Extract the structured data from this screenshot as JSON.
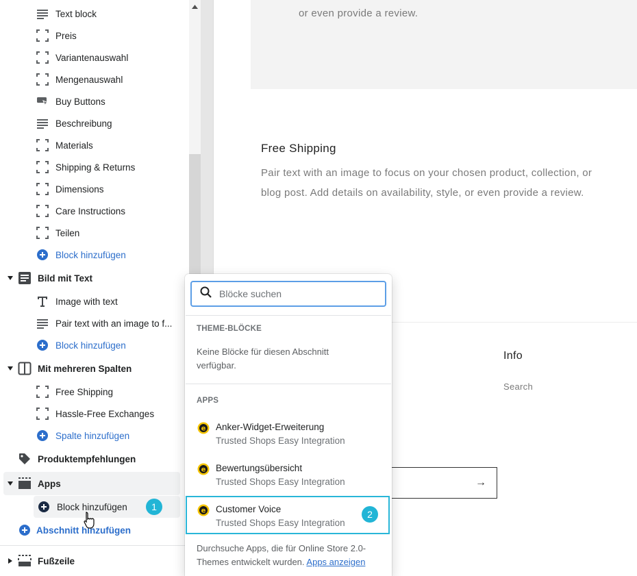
{
  "sidebar": {
    "product_blocks": [
      {
        "icon": "text-lines-icon",
        "label": "Text block"
      },
      {
        "icon": "dashed-block-icon",
        "label": "Preis"
      },
      {
        "icon": "dashed-block-icon",
        "label": "Variantenauswahl"
      },
      {
        "icon": "dashed-block-icon",
        "label": "Mengenauswahl"
      },
      {
        "icon": "buy-button-icon",
        "label": "Buy Buttons"
      },
      {
        "icon": "text-lines-icon",
        "label": "Beschreibung"
      },
      {
        "icon": "dashed-block-icon",
        "label": "Materials"
      },
      {
        "icon": "dashed-block-icon",
        "label": "Shipping & Returns"
      },
      {
        "icon": "dashed-block-icon",
        "label": "Dimensions"
      },
      {
        "icon": "dashed-block-icon",
        "label": "Care Instructions"
      },
      {
        "icon": "dashed-block-icon",
        "label": "Teilen"
      }
    ],
    "add_block_1": "Block hinzufügen",
    "section_image_text": "Bild mit Text",
    "image_text_blocks": [
      {
        "icon": "text-t-icon",
        "label": "Image with text"
      },
      {
        "icon": "text-lines-icon",
        "label": "Pair text with an image to f..."
      }
    ],
    "add_block_2": "Block hinzufügen",
    "section_columns": "Mit mehreren Spalten",
    "column_blocks": [
      {
        "icon": "dashed-block-icon",
        "label": "Free Shipping"
      },
      {
        "icon": "dashed-block-icon",
        "label": "Hassle-Free Exchanges"
      }
    ],
    "add_column": "Spalte hinzufügen",
    "section_recommendations": "Produktempfehlungen",
    "section_apps": "Apps",
    "add_block_apps": "Block hinzufügen",
    "add_section": "Abschnitt hinzufügen",
    "section_footer": "Fußzeile",
    "step1": "1"
  },
  "preview": {
    "top_text": "or even provide a review.",
    "heading": "Free Shipping",
    "body_line1": "Pair text with an image to focus on your chosen product, collection, or",
    "body_line2": "blog post. Add details on availability, style, or even provide a review.",
    "info_heading": "Info",
    "search_link": "Search",
    "arrow": "→"
  },
  "dropdown": {
    "search_placeholder": "Blöcke suchen",
    "theme_header": "THEME-BLÖCKE",
    "theme_note_line1": "Keine Blöcke für diesen Abschnitt",
    "theme_note_line2": "verfügbar.",
    "apps_header": "APPS",
    "apps": [
      {
        "name": "Anker-Widget-Erweiterung",
        "vendor": "Trusted Shops Easy Integration"
      },
      {
        "name": "Bewertungsübersicht",
        "vendor": "Trusted Shops Easy Integration"
      },
      {
        "name": "Customer Voice",
        "vendor": "Trusted Shops Easy Integration"
      }
    ],
    "footer_line1": "Durchsuche Apps, die für Online Store 2.0-",
    "footer_line2": "Themes entwickelt wurden.",
    "footer_link": "Apps anzeigen",
    "step2": "2"
  },
  "colors": {
    "link": "#2c6ecb",
    "badge": "#22b5d6",
    "search_focus": "#5c9ee6"
  }
}
